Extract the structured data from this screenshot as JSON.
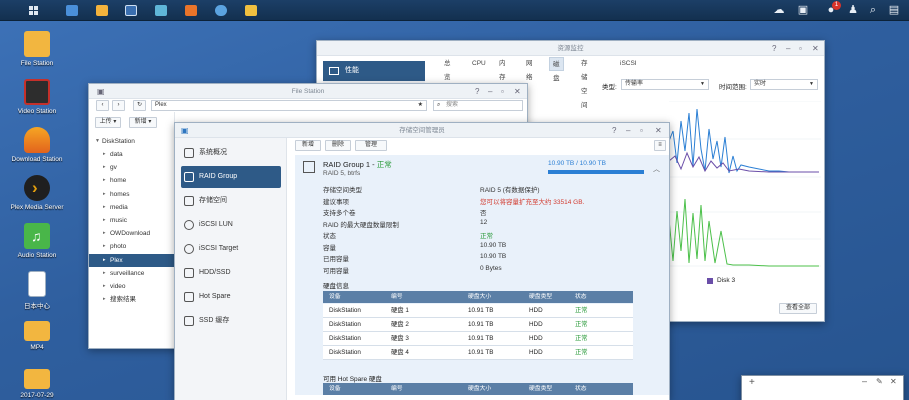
{
  "desktop": {
    "icons": [
      {
        "label": "File Station"
      },
      {
        "label": "Video Station"
      },
      {
        "label": "Download Station"
      },
      {
        "label": "Plex Media Server"
      },
      {
        "label": "Audio Station"
      },
      {
        "label": "日本中心"
      },
      {
        "label": "MP4"
      },
      {
        "label": "2017-07-29"
      }
    ]
  },
  "resource_monitor": {
    "title": "资源监控",
    "sidebar_selected": "性能",
    "tabs": [
      "总览",
      "CPU",
      "内存",
      "网络",
      "磁盘",
      "存储空间",
      "iSCSI"
    ],
    "active_tab": "磁盘",
    "type_label": "类型:",
    "type_value": "传输率",
    "time_label": "时间范围:",
    "time_value": "实时",
    "legend": "Disk 3",
    "view_all": "查看全部"
  },
  "file_station": {
    "title": "File Station",
    "path": "Plex",
    "search_placeholder": "搜索",
    "upload": "上传 ▾",
    "new": "新增 ▾",
    "root": "DiskStation",
    "folders": [
      "data",
      "gv",
      "home",
      "homes",
      "media",
      "music",
      "OWDownload",
      "photo",
      "Plex",
      "surveillance",
      "video",
      "搜索结果"
    ],
    "selected": "Plex"
  },
  "storage_manager": {
    "title": "存储空间管理员",
    "toolbar": [
      "新增",
      "删除",
      "管理"
    ],
    "nav": [
      "系统概况",
      "RAID Group",
      "存储空间",
      "iSCSI LUN",
      "iSCSI Target",
      "HDD/SSD",
      "Hot Spare",
      "SSD 缓存"
    ],
    "selected_nav": "RAID Group",
    "raid": {
      "name": "RAID Group 1 - ",
      "status_short": "正常",
      "sub": "RAID 5, btrfs",
      "usage": "10.90 TB / 10.90 TB",
      "usage_fraction": 1.0,
      "props": [
        {
          "k": "存储空间类型",
          "v": "RAID 5 (有数据保护)",
          "style": ""
        },
        {
          "k": "建议事项",
          "v": "您可以将容量扩充至大约 33514 GB.",
          "style": "warn"
        },
        {
          "k": "支持多个卷",
          "v": "否",
          "style": ""
        },
        {
          "k": "RAID 的最大硬盘数量限制",
          "v": "12",
          "style": ""
        },
        {
          "k": "状态",
          "v": "正常",
          "style": "ok"
        },
        {
          "k": "容量",
          "v": "10.90 TB",
          "style": ""
        },
        {
          "k": "已用容量",
          "v": "10.90 TB",
          "style": ""
        },
        {
          "k": "可用容量",
          "v": "0 Bytes",
          "style": ""
        }
      ],
      "disk_info_title": "硬盘信息",
      "disk_headers": [
        "设备",
        "编号",
        "硬盘大小",
        "硬盘类型",
        "状态"
      ],
      "disks": [
        {
          "device": "DiskStation",
          "no": "硬盘 1",
          "size": "10.91 TB",
          "type": "HDD",
          "status": "正常"
        },
        {
          "device": "DiskStation",
          "no": "硬盘 2",
          "size": "10.91 TB",
          "type": "HDD",
          "status": "正常"
        },
        {
          "device": "DiskStation",
          "no": "硬盘 3",
          "size": "10.91 TB",
          "type": "HDD",
          "status": "正常"
        },
        {
          "device": "DiskStation",
          "no": "硬盘 4",
          "size": "10.91 TB",
          "type": "HDD",
          "status": "正常"
        }
      ],
      "hotspare_title": "可用 Hot Spare 硬盘",
      "hotspare_headers": [
        "设备",
        "编号",
        "硬盘大小",
        "硬盘类型",
        "状态"
      ]
    }
  },
  "colors": {
    "accent": "#2e5a87",
    "ok": "#2a9a3a",
    "warn": "#d23c30",
    "chart_purple": "#6a4ea8",
    "chart_blue": "#2b7fd4",
    "chart_green": "#4cc04a"
  }
}
